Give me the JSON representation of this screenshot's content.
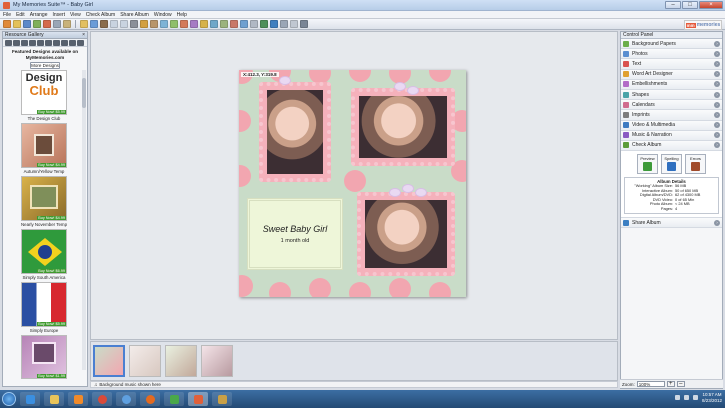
{
  "window": {
    "title": "My Memories Suite™ - Baby Girl",
    "ctrl_min": "–",
    "ctrl_max": "□",
    "ctrl_close": "×"
  },
  "menu": [
    "File",
    "Edit",
    "Arrange",
    "Insert",
    "View",
    "Check Album",
    "Share Album",
    "Window",
    "Help"
  ],
  "logo": {
    "badge": "mm",
    "text": "memories"
  },
  "gallery": {
    "title": "Resource Gallery",
    "close": "×",
    "featured": "Featured Designs available on MyMemories.com",
    "more_button": "More Designs",
    "club_word1": "Design",
    "club_word2": "Club",
    "items": [
      {
        "label": "The Design Club",
        "buy": "Buy Now! $5.99"
      },
      {
        "label": "Autumn/Yellow Temp",
        "buy": "Buy Now! $4.99"
      },
      {
        "label": "Nearly November Temp",
        "buy": "Buy Now! $4.99"
      },
      {
        "label": "Simply South America",
        "buy": "Buy Now! $6.99"
      },
      {
        "label": "Simply Europe",
        "buy": "Buy Now! $5.99"
      },
      {
        "label": "",
        "buy": "Buy Now! $1.99"
      }
    ]
  },
  "canvas": {
    "coords": "X:412.3, Y:319.8",
    "text_line1": "Sweet Baby Girl",
    "text_line2": "1 month old"
  },
  "music_bar": {
    "label": "Background music shown here",
    "icon": "music-note-icon"
  },
  "control_panel": {
    "title": "Control Panel",
    "items": [
      {
        "label": "Background Papers",
        "color": "#6cae4a"
      },
      {
        "label": "Photos",
        "color": "#5b8fd0"
      },
      {
        "label": "Text",
        "color": "#d9534f"
      },
      {
        "label": "Word Art Designer",
        "color": "#e0a030"
      },
      {
        "label": "Embellishments",
        "color": "#b36cc7"
      },
      {
        "label": "Shapes",
        "color": "#4aa3a8"
      },
      {
        "label": "Calendars",
        "color": "#d06b8e"
      },
      {
        "label": "Imprints",
        "color": "#7c7c7c"
      },
      {
        "label": "Video & Multimedia",
        "color": "#3f7bc1"
      },
      {
        "label": "Music & Narration",
        "color": "#8a5ac2"
      },
      {
        "label": "Check Album",
        "color": "#5c9d3a"
      }
    ],
    "check": {
      "buttons": [
        {
          "label": "Preview",
          "color": "#3d9a3a"
        },
        {
          "label": "Spelling",
          "color": "#2f6fbf"
        },
        {
          "label": "Errors",
          "color": "#a04a2a"
        }
      ],
      "details_title": "Album Details",
      "rows": [
        {
          "k": "\"Working\" Album Size:",
          "v": "56 MB"
        },
        {
          "k": "Interactive Album:",
          "v": "50 of 650 MB"
        },
        {
          "k": "Digital Album/DVD:",
          "v": "62 of 4300 MB"
        },
        {
          "k": "DVD Video:",
          "v": "0 of 65 Min"
        },
        {
          "k": "Photo Album:",
          "v": "< 24 MB"
        },
        {
          "k": "Pages:",
          "v": "4"
        }
      ]
    },
    "share": {
      "label": "Share Album",
      "color": "#3c7fc2"
    }
  },
  "zoom": {
    "label": "Zoom:",
    "value": "100%",
    "plus": "+",
    "minus": "–"
  },
  "taskbar": {
    "time": "10:57 AM",
    "date": "8/23/2012"
  }
}
